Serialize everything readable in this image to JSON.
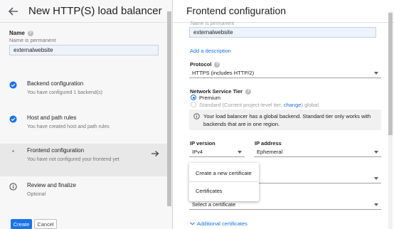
{
  "left": {
    "title": "New HTTP(S) load balancer",
    "name_label": "Name",
    "name_hint": "Name is permanent",
    "name_value": "externalwebsite",
    "steps": [
      {
        "title": "Backend configuration",
        "subtitle": "You have configured 1 backend(s)",
        "icon": "check-circle-icon"
      },
      {
        "title": "Host and path rules",
        "subtitle": "You have created host and path rules",
        "icon": "check-circle-icon"
      },
      {
        "title": "Frontend configuration",
        "subtitle": "You have not configured your frontend yet",
        "icon": "dot-icon"
      },
      {
        "title": "Review and finalize",
        "subtitle": "Optional",
        "icon": "info-icon"
      }
    ],
    "create_label": "Create",
    "cancel_label": "Cancel"
  },
  "right": {
    "title": "Frontend configuration",
    "name_hint": "Name is permanent",
    "name_value": "externalwebsite",
    "add_description": "Add a description",
    "protocol_label": "Protocol",
    "protocol_value": "HTTPS (includes HTTP/2)",
    "tier_label": "Network Service Tier",
    "tier_premium": "Premium",
    "tier_standard_prefix": "Standard (Current project-level tier,",
    "tier_standard_link": "change",
    "tier_standard_suffix": ") global",
    "info_text": "Your load balancer has a global backend. Standard tier only works with backends that are in one region.",
    "ip_version_label": "IP version",
    "ip_version_value": "IPv4",
    "ip_address_label": "IP address",
    "ip_address_value": "Ephemeral",
    "menu": [
      "Create a new certificate",
      "Certificates"
    ],
    "certificate_placeholder": "Select a certificate",
    "additional_certificates": "Additional certificates"
  },
  "colors": {
    "accent": "#1a73e8",
    "panel_bg": "#f7f7f7",
    "active_step": "#e8e8e8"
  }
}
